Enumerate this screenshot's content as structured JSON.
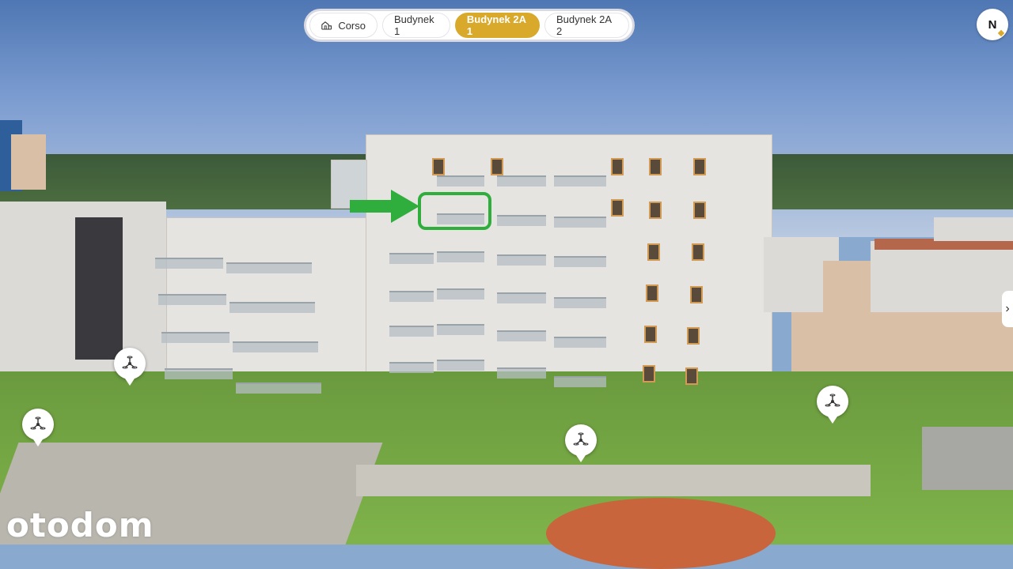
{
  "tabs": [
    {
      "label": "Corso",
      "icon": "building-icon",
      "active": false
    },
    {
      "label": "Budynek 1",
      "active": false
    },
    {
      "label": "Budynek 2A 1",
      "active": true
    },
    {
      "label": "Budynek 2A 2",
      "active": false
    }
  ],
  "compass": {
    "label": "N"
  },
  "logo": {
    "text": "otodom"
  },
  "colors": {
    "accent": "#d9a92b",
    "highlight": "#2fae3e"
  }
}
